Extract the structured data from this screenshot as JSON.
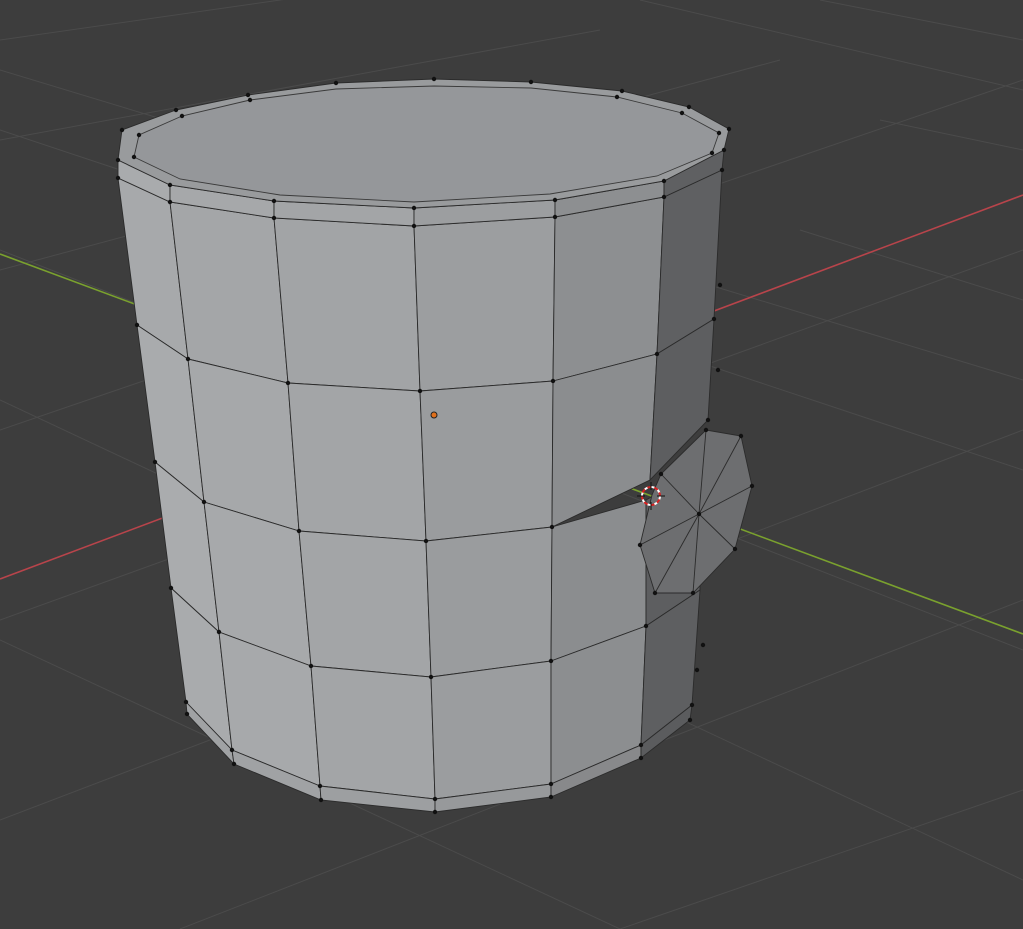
{
  "viewport": {
    "mode": "edit-mode-3d-viewport",
    "background_color": "#3d3d3d",
    "grid_color": "#4a4a4a",
    "x_axis_color": "#b8444b",
    "y_axis_color": "#7aa12e",
    "mesh_face_color": "#999b9d",
    "mesh_edge_color": "#2a2a2a",
    "vertex_color": "#111111",
    "origin_color": "#e0701c",
    "cursor_color": "#d82020"
  },
  "objects": [
    {
      "name_icon": "cylinder-mesh",
      "segments": 16,
      "loops": 5
    },
    {
      "name_icon": "disc-mesh",
      "segments": 8
    }
  ]
}
